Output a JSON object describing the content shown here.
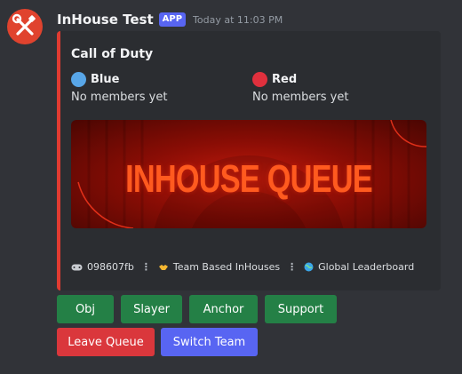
{
  "message": {
    "username": "InHouse Test",
    "badge": "APP",
    "timestamp": "Today at 11:03 PM"
  },
  "embed": {
    "accent_color": "#e03b31",
    "title": "Call of Duty",
    "teams": [
      {
        "name": "Blue",
        "color": "#58a6e8",
        "members": "No members yet"
      },
      {
        "name": "Red",
        "color": "#e0303d",
        "members": "No members yet"
      }
    ],
    "banner_text": "INHOUSE QUEUE",
    "footer": [
      {
        "icon": "gamepad-icon",
        "text": "098607fb"
      },
      {
        "icon": "handshake-icon",
        "text": "Team Based InHouses"
      },
      {
        "icon": "globe-icon",
        "text": "Global Leaderboard"
      }
    ]
  },
  "buttons": {
    "row1": [
      "Obj",
      "Slayer",
      "Anchor",
      "Support"
    ],
    "row2": [
      "Leave Queue",
      "Switch Team"
    ]
  }
}
